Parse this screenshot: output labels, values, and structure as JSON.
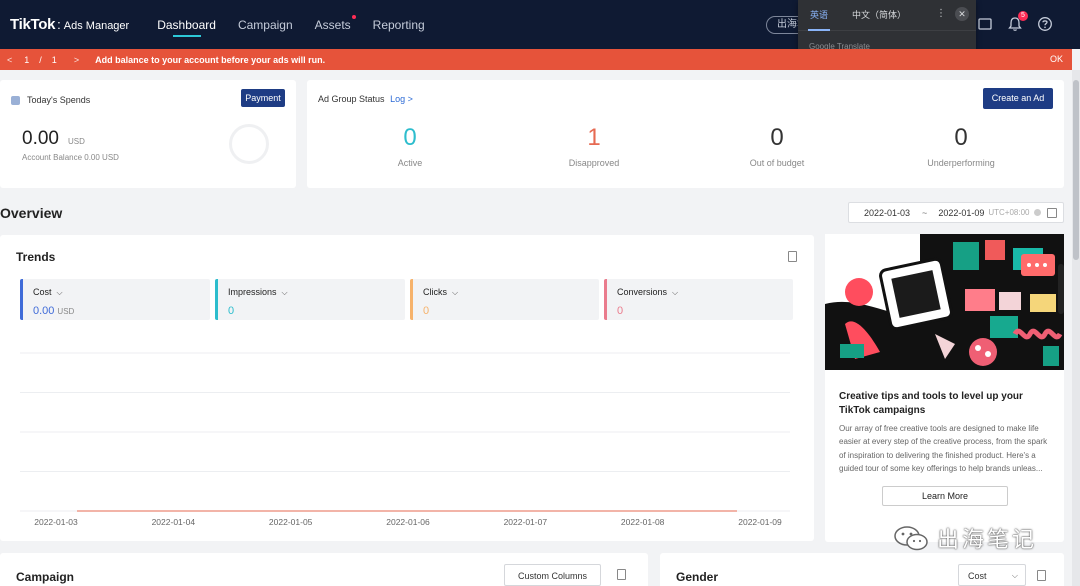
{
  "nav": {
    "logo_tiktok": "TikTok",
    "logo_sep": ":",
    "logo_product": "Ads Manager",
    "links": [
      {
        "label": "Dashboard",
        "active": true
      },
      {
        "label": "Campaign"
      },
      {
        "label": "Assets",
        "dot": true
      },
      {
        "label": "Reporting"
      }
    ],
    "account_pill": "出海笔",
    "notification_count": "5"
  },
  "translate": {
    "tab_source": "英语",
    "tab_target": "中文（简体）",
    "more": "⋮",
    "close": "✕",
    "brand": "Google Translate"
  },
  "alert": {
    "prev": "<",
    "page": "1",
    "slash": "/",
    "total": "1",
    "next": ">",
    "message": "Add balance to your account before your ads will run.",
    "ok": "OK"
  },
  "spends": {
    "title": "Today's Spends",
    "payment_label": "Payment",
    "amount": "0.00",
    "currency": "USD",
    "balance": "Account Balance 0.00 USD"
  },
  "ad_group": {
    "title": "Ad Group Status",
    "log_label": "Log",
    "log_chevron": ">",
    "create_label": "Create an Ad",
    "stats": [
      {
        "value": "0",
        "label": "Active",
        "color": "#2dbdcd"
      },
      {
        "value": "1",
        "label": "Disapproved",
        "color": "#e66a52"
      },
      {
        "value": "0",
        "label": "Out of budget",
        "color": "#333333"
      },
      {
        "value": "0",
        "label": "Underperforming",
        "color": "#333333"
      }
    ]
  },
  "overview": {
    "title": "Overview",
    "date_from": "2022-01-03",
    "tilde": "~",
    "date_to": "2022-01-09",
    "timezone": "UTC+08:00"
  },
  "trends": {
    "title": "Trends",
    "metrics": [
      {
        "name": "Cost",
        "value": "0.00",
        "unit": "USD",
        "color": "#3f6bd8",
        "value_color": "#3f6bd8"
      },
      {
        "name": "Impressions",
        "value": "0",
        "unit": "",
        "color": "#2dbdcd",
        "value_color": "#2dbdcd"
      },
      {
        "name": "Clicks",
        "value": "0",
        "unit": "",
        "color": "#f6b26b",
        "value_color": "#f6b26b"
      },
      {
        "name": "Conversions",
        "value": "0",
        "unit": "",
        "color": "#ea7c8d",
        "value_color": "#ea7c8d"
      }
    ]
  },
  "chart_data": {
    "type": "line",
    "x": [
      "2022-01-03",
      "2022-01-04",
      "2022-01-05",
      "2022-01-06",
      "2022-01-07",
      "2022-01-08",
      "2022-01-09"
    ],
    "series": [
      {
        "values": [
          0,
          0,
          0,
          0,
          0,
          0,
          0
        ],
        "color": "#e66a52"
      }
    ],
    "grid": true,
    "ylim": [
      0,
      1
    ]
  },
  "promo": {
    "title": "Creative tips and tools to level up your TikTok campaigns",
    "text": "Our array of free creative tools are designed to make life easier at every step of the creative process, from the spark of inspiration to delivering the finished product. Here's a guided tour of some key offerings to help brands unleas...",
    "learn_label": "Learn More"
  },
  "campaign": {
    "title": "Campaign",
    "custom_columns": "Custom Columns"
  },
  "gender": {
    "title": "Gender",
    "metric_selected": "Cost"
  },
  "watermark": {
    "text": "出海笔记"
  }
}
